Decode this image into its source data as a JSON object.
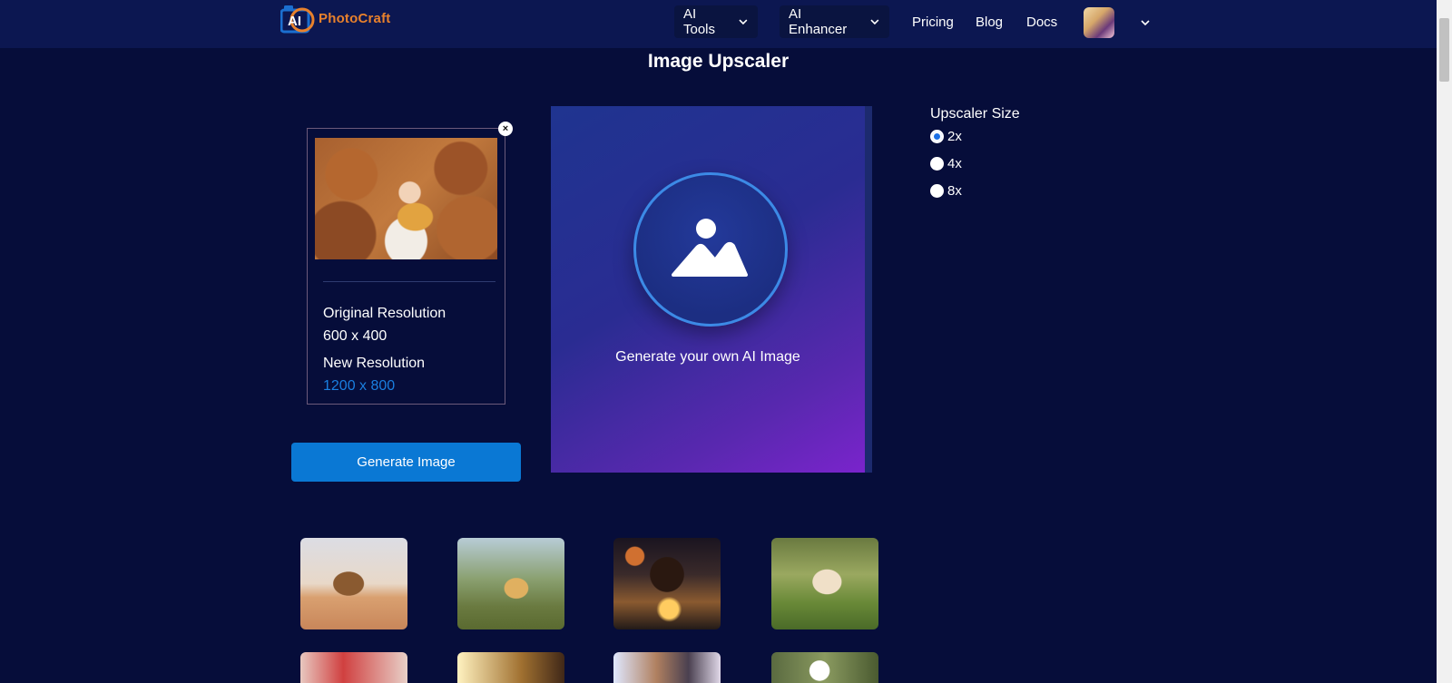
{
  "header": {
    "logo_ai": "AI",
    "logo_text": "PhotoCraft",
    "nav": {
      "ai_tools": "AI Tools",
      "ai_enhancer": "AI Enhancer",
      "pricing": "Pricing",
      "blog": "Blog",
      "docs": "Docs"
    }
  },
  "page": {
    "title": "Image Upscaler"
  },
  "preview": {
    "close_icon": "×",
    "original_label": "Original Resolution",
    "original_value": "600 x 400",
    "new_label": "New Resolution",
    "new_value": "1200 x 800"
  },
  "actions": {
    "generate_label": "Generate Image"
  },
  "generator": {
    "prompt_text": "Generate your own AI Image"
  },
  "upscaler": {
    "title": "Upscaler Size",
    "options": [
      {
        "label": "2x",
        "checked": true
      },
      {
        "label": "4x",
        "checked": false
      },
      {
        "label": "8x",
        "checked": false
      }
    ]
  },
  "thumbnails": [
    {
      "icon": "camel-photo"
    },
    {
      "icon": "child-in-garden-photo"
    },
    {
      "icon": "girl-with-lights-photo"
    },
    {
      "icon": "puppy-photo"
    },
    {
      "icon": "red-blur-photo"
    },
    {
      "icon": "sunlight-photo"
    },
    {
      "icon": "mother-child-photo"
    },
    {
      "icon": "white-flower-photo"
    }
  ],
  "colors": {
    "background": "#060d3a",
    "header": "#0c1751",
    "accent_blue": "#0a78d4",
    "new_resolution": "#1a7fe0",
    "logo_orange": "#e8812c"
  }
}
